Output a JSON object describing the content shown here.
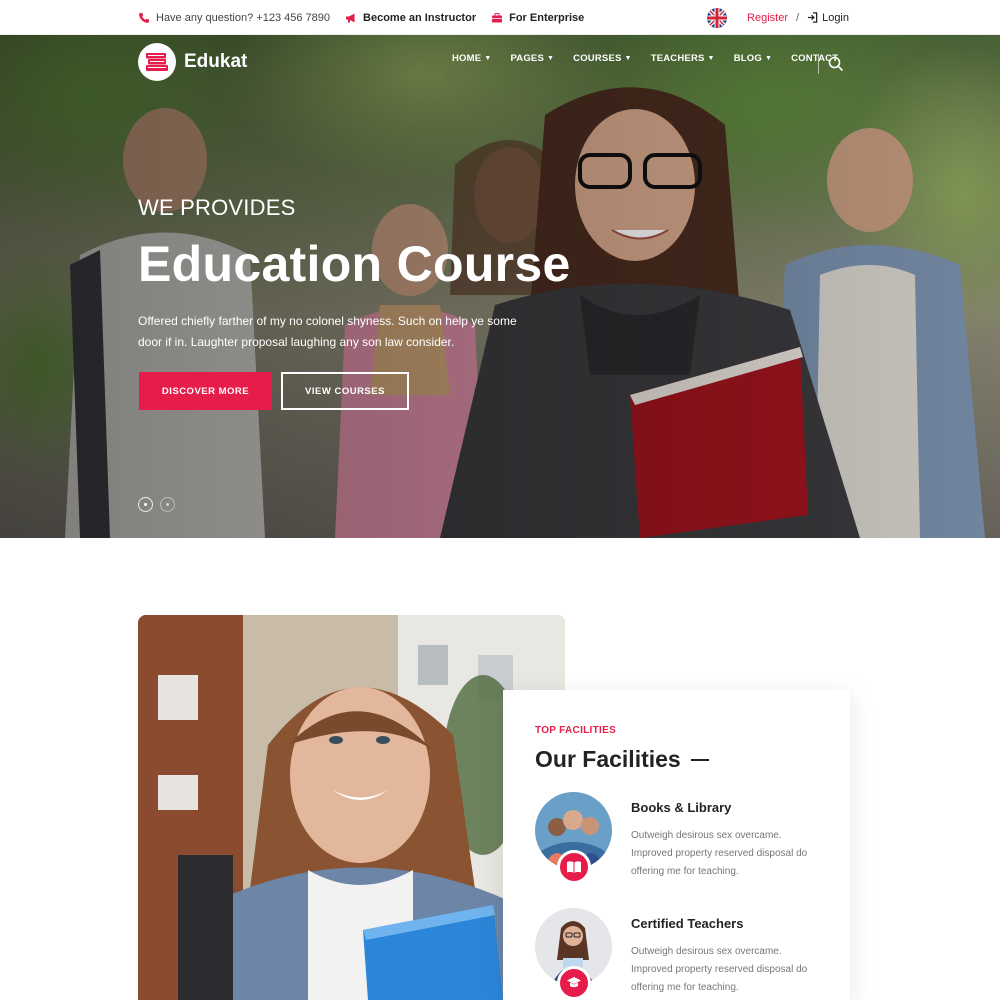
{
  "topbar": {
    "phone": "Have any question? +123 456 7890",
    "instructor": "Become an Instructor",
    "enterprise": "For Enterprise",
    "register": "Register",
    "separator": "/",
    "login": "Login"
  },
  "header": {
    "logo": "Edukat",
    "nav": [
      {
        "label": "HOME"
      },
      {
        "label": "PAGES"
      },
      {
        "label": "COURSES"
      },
      {
        "label": "TEACHERS"
      },
      {
        "label": "BLOG"
      },
      {
        "label": "CONTACT"
      }
    ]
  },
  "hero": {
    "subtitle": "WE PROVIDES",
    "title": "Education Course",
    "description": "Offered chiefly farther of my no colonel shyness. Such on help ye some door if in. Laughter proposal laughing any son law consider.",
    "primary_button": "DISCOVER MORE",
    "secondary_button": "VIEW COURSES"
  },
  "facilities": {
    "eyebrow": "TOP FACILITIES",
    "title": "Our Facilities",
    "items": [
      {
        "title": "Books & Library",
        "description": "Outweigh desirous sex overcame. Improved property reserved disposal do offering me for teaching.",
        "icon": "book-icon"
      },
      {
        "title": "Certified Teachers",
        "description": "Outweigh desirous sex overcame. Improved property reserved disposal do offering me for teaching.",
        "icon": "graduate-icon"
      }
    ]
  },
  "colors": {
    "accent": "#e61d4a",
    "heading": "#232323",
    "body_text": "#777777"
  }
}
